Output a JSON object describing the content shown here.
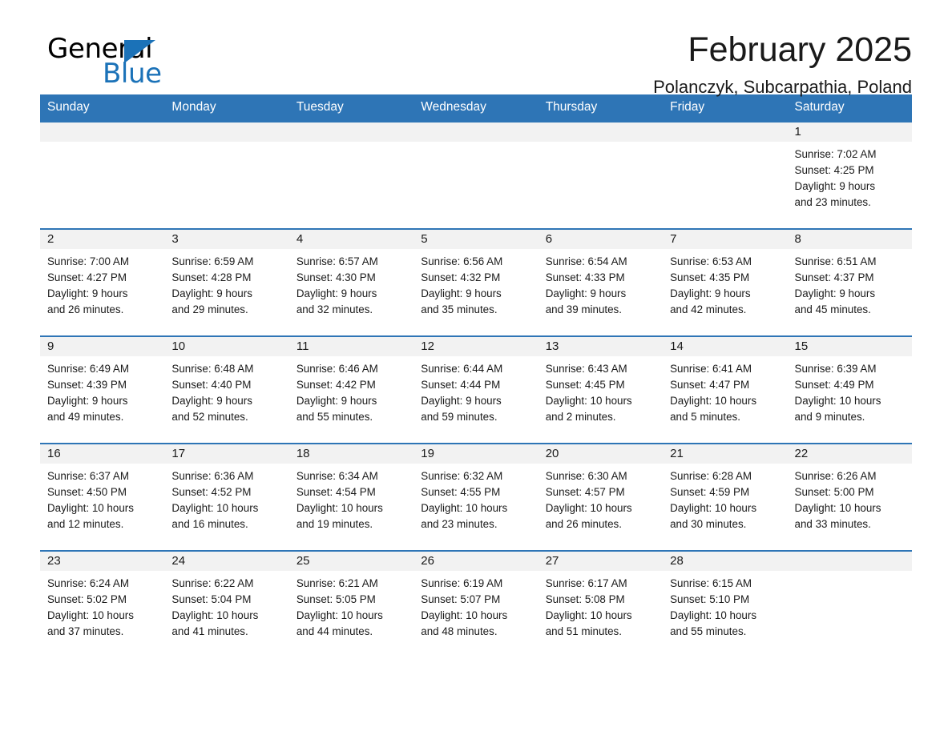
{
  "brand": {
    "name_dark": "General",
    "name_blue": "Blue",
    "triangle_color": "#1b72b8"
  },
  "header": {
    "month_title": "February 2025",
    "location": "Polanczyk, Subcarpathia, Poland"
  },
  "calendar": {
    "header_bg": "#2e75b6",
    "daynum_bg": "#f2f2f2",
    "weekday_headers": [
      "Sunday",
      "Monday",
      "Tuesday",
      "Wednesday",
      "Thursday",
      "Friday",
      "Saturday"
    ],
    "weeks": [
      [
        {
          "day": "",
          "lines": []
        },
        {
          "day": "",
          "lines": []
        },
        {
          "day": "",
          "lines": []
        },
        {
          "day": "",
          "lines": []
        },
        {
          "day": "",
          "lines": []
        },
        {
          "day": "",
          "lines": []
        },
        {
          "day": "1",
          "lines": [
            "Sunrise: 7:02 AM",
            "Sunset: 4:25 PM",
            "Daylight: 9 hours",
            "and 23 minutes."
          ]
        }
      ],
      [
        {
          "day": "2",
          "lines": [
            "Sunrise: 7:00 AM",
            "Sunset: 4:27 PM",
            "Daylight: 9 hours",
            "and 26 minutes."
          ]
        },
        {
          "day": "3",
          "lines": [
            "Sunrise: 6:59 AM",
            "Sunset: 4:28 PM",
            "Daylight: 9 hours",
            "and 29 minutes."
          ]
        },
        {
          "day": "4",
          "lines": [
            "Sunrise: 6:57 AM",
            "Sunset: 4:30 PM",
            "Daylight: 9 hours",
            "and 32 minutes."
          ]
        },
        {
          "day": "5",
          "lines": [
            "Sunrise: 6:56 AM",
            "Sunset: 4:32 PM",
            "Daylight: 9 hours",
            "and 35 minutes."
          ]
        },
        {
          "day": "6",
          "lines": [
            "Sunrise: 6:54 AM",
            "Sunset: 4:33 PM",
            "Daylight: 9 hours",
            "and 39 minutes."
          ]
        },
        {
          "day": "7",
          "lines": [
            "Sunrise: 6:53 AM",
            "Sunset: 4:35 PM",
            "Daylight: 9 hours",
            "and 42 minutes."
          ]
        },
        {
          "day": "8",
          "lines": [
            "Sunrise: 6:51 AM",
            "Sunset: 4:37 PM",
            "Daylight: 9 hours",
            "and 45 minutes."
          ]
        }
      ],
      [
        {
          "day": "9",
          "lines": [
            "Sunrise: 6:49 AM",
            "Sunset: 4:39 PM",
            "Daylight: 9 hours",
            "and 49 minutes."
          ]
        },
        {
          "day": "10",
          "lines": [
            "Sunrise: 6:48 AM",
            "Sunset: 4:40 PM",
            "Daylight: 9 hours",
            "and 52 minutes."
          ]
        },
        {
          "day": "11",
          "lines": [
            "Sunrise: 6:46 AM",
            "Sunset: 4:42 PM",
            "Daylight: 9 hours",
            "and 55 minutes."
          ]
        },
        {
          "day": "12",
          "lines": [
            "Sunrise: 6:44 AM",
            "Sunset: 4:44 PM",
            "Daylight: 9 hours",
            "and 59 minutes."
          ]
        },
        {
          "day": "13",
          "lines": [
            "Sunrise: 6:43 AM",
            "Sunset: 4:45 PM",
            "Daylight: 10 hours",
            "and 2 minutes."
          ]
        },
        {
          "day": "14",
          "lines": [
            "Sunrise: 6:41 AM",
            "Sunset: 4:47 PM",
            "Daylight: 10 hours",
            "and 5 minutes."
          ]
        },
        {
          "day": "15",
          "lines": [
            "Sunrise: 6:39 AM",
            "Sunset: 4:49 PM",
            "Daylight: 10 hours",
            "and 9 minutes."
          ]
        }
      ],
      [
        {
          "day": "16",
          "lines": [
            "Sunrise: 6:37 AM",
            "Sunset: 4:50 PM",
            "Daylight: 10 hours",
            "and 12 minutes."
          ]
        },
        {
          "day": "17",
          "lines": [
            "Sunrise: 6:36 AM",
            "Sunset: 4:52 PM",
            "Daylight: 10 hours",
            "and 16 minutes."
          ]
        },
        {
          "day": "18",
          "lines": [
            "Sunrise: 6:34 AM",
            "Sunset: 4:54 PM",
            "Daylight: 10 hours",
            "and 19 minutes."
          ]
        },
        {
          "day": "19",
          "lines": [
            "Sunrise: 6:32 AM",
            "Sunset: 4:55 PM",
            "Daylight: 10 hours",
            "and 23 minutes."
          ]
        },
        {
          "day": "20",
          "lines": [
            "Sunrise: 6:30 AM",
            "Sunset: 4:57 PM",
            "Daylight: 10 hours",
            "and 26 minutes."
          ]
        },
        {
          "day": "21",
          "lines": [
            "Sunrise: 6:28 AM",
            "Sunset: 4:59 PM",
            "Daylight: 10 hours",
            "and 30 minutes."
          ]
        },
        {
          "day": "22",
          "lines": [
            "Sunrise: 6:26 AM",
            "Sunset: 5:00 PM",
            "Daylight: 10 hours",
            "and 33 minutes."
          ]
        }
      ],
      [
        {
          "day": "23",
          "lines": [
            "Sunrise: 6:24 AM",
            "Sunset: 5:02 PM",
            "Daylight: 10 hours",
            "and 37 minutes."
          ]
        },
        {
          "day": "24",
          "lines": [
            "Sunrise: 6:22 AM",
            "Sunset: 5:04 PM",
            "Daylight: 10 hours",
            "and 41 minutes."
          ]
        },
        {
          "day": "25",
          "lines": [
            "Sunrise: 6:21 AM",
            "Sunset: 5:05 PM",
            "Daylight: 10 hours",
            "and 44 minutes."
          ]
        },
        {
          "day": "26",
          "lines": [
            "Sunrise: 6:19 AM",
            "Sunset: 5:07 PM",
            "Daylight: 10 hours",
            "and 48 minutes."
          ]
        },
        {
          "day": "27",
          "lines": [
            "Sunrise: 6:17 AM",
            "Sunset: 5:08 PM",
            "Daylight: 10 hours",
            "and 51 minutes."
          ]
        },
        {
          "day": "28",
          "lines": [
            "Sunrise: 6:15 AM",
            "Sunset: 5:10 PM",
            "Daylight: 10 hours",
            "and 55 minutes."
          ]
        },
        {
          "day": "",
          "lines": []
        }
      ]
    ]
  }
}
